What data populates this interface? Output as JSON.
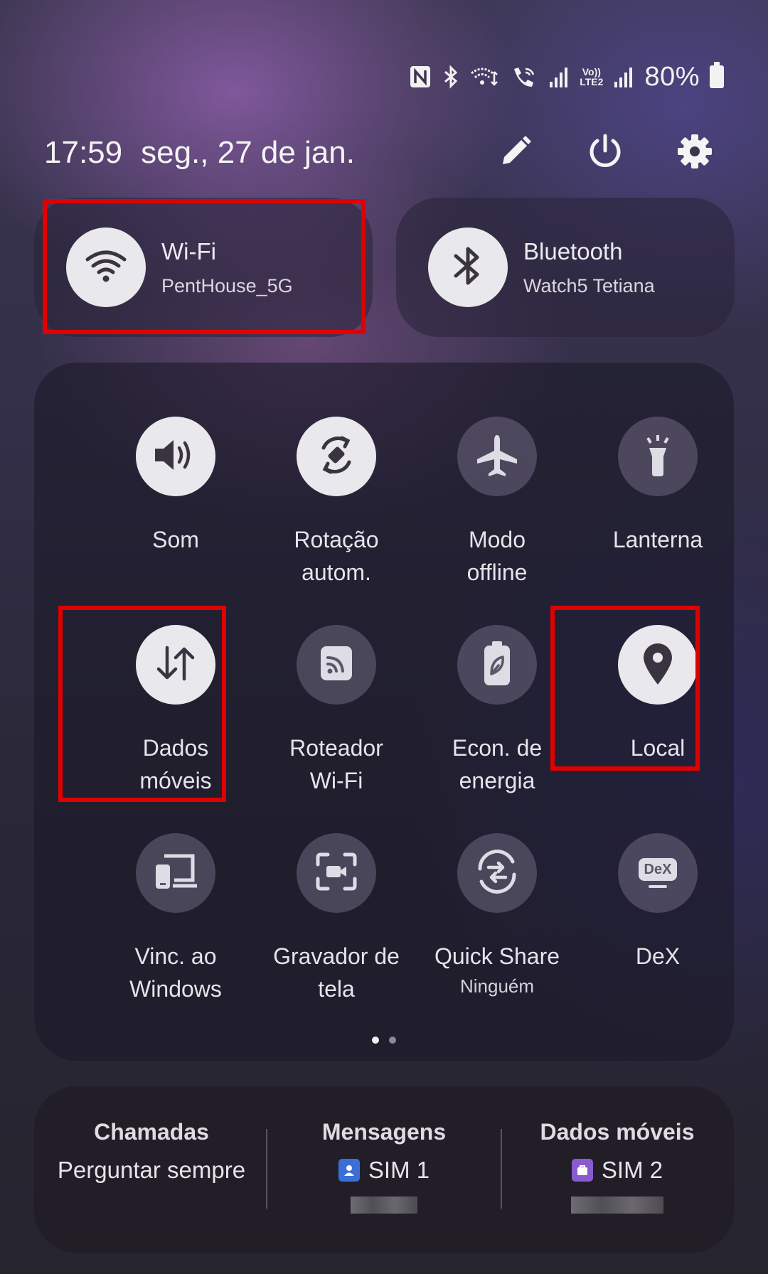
{
  "status_bar": {
    "battery_percent": "80%",
    "volte_label_top": "Vo))",
    "volte_label_bottom": "LTE2",
    "icons": [
      "nfc-icon",
      "bluetooth-icon",
      "wifi-calling-icon",
      "wifi-call-icon",
      "signal-icon",
      "volte-icon",
      "signal-icon",
      "battery-icon"
    ]
  },
  "header": {
    "time": "17:59",
    "date": "seg., 27 de jan.",
    "actions": [
      "edit-icon",
      "power-icon",
      "settings-icon"
    ]
  },
  "wifi_tile": {
    "label": "Wi-Fi",
    "network": "PentHouse_5G",
    "state": "on"
  },
  "bluetooth_tile": {
    "label": "Bluetooth",
    "device": "Watch5 Tetiana",
    "state": "on"
  },
  "quick_tiles": [
    {
      "label": "Som",
      "state": "on",
      "icon": "volume-icon"
    },
    {
      "label": "Rotação\nautom.",
      "state": "on",
      "icon": "auto-rotate-icon"
    },
    {
      "label": "Modo\noffline",
      "state": "off",
      "icon": "airplane-icon"
    },
    {
      "label": "Lanterna",
      "state": "off",
      "icon": "flashlight-icon"
    },
    {
      "label": "Dados\nmóveis",
      "state": "on",
      "icon": "mobile-data-icon"
    },
    {
      "label": "Roteador\nWi-Fi",
      "state": "off",
      "icon": "hotspot-icon"
    },
    {
      "label": "Econ. de\nenergia",
      "state": "off",
      "icon": "power-saving-icon"
    },
    {
      "label": "Local",
      "state": "on",
      "icon": "location-icon"
    },
    {
      "label": "Vinc. ao\nWindows",
      "state": "off",
      "icon": "link-to-windows-icon"
    },
    {
      "label": "Gravador de\ntela",
      "state": "off",
      "icon": "screen-recorder-icon"
    },
    {
      "label": "Quick Share",
      "sublabel": "Ninguém",
      "state": "off",
      "icon": "quick-share-icon"
    },
    {
      "label": "DeX",
      "state": "off",
      "icon": "dex-icon",
      "icon_text": "DeX"
    }
  ],
  "pagination": {
    "pages": 2,
    "current": 1
  },
  "sim_manager": {
    "calls": {
      "title": "Chamadas",
      "value": "Perguntar sempre"
    },
    "messages": {
      "title": "Mensagens",
      "value": "SIM 1",
      "badge_color": "#3a6fd8"
    },
    "mobile_data": {
      "title": "Dados móveis",
      "value": "SIM 2",
      "badge_color": "#8a5bd0"
    }
  },
  "colors": {
    "highlight": "#e00000",
    "tile_on": "#e9e8ec",
    "tile_off": "#6e6880"
  }
}
